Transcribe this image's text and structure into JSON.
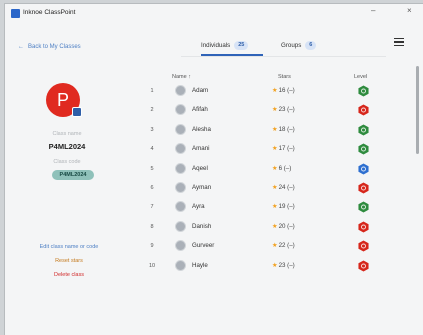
{
  "app": {
    "title": "Inknoe ClassPoint",
    "min": "–",
    "close": "×"
  },
  "nav": {
    "back": "Back to My Classes"
  },
  "tabs": [
    {
      "label": "Individuals",
      "count": "25"
    },
    {
      "label": "Groups",
      "count": "6"
    }
  ],
  "class": {
    "avatar_letter": "P",
    "name_label": "Class name",
    "name": "P4ML2024",
    "code_label": "Class code",
    "code": "P4ML2024"
  },
  "actions": {
    "edit": "Edit class name or code",
    "reset": "Reset stars",
    "delete": "Delete class"
  },
  "table": {
    "col_name": "Name ↑",
    "col_stars": "Stars",
    "col_level": "Level",
    "rows": [
      {
        "rank": "1",
        "name": "Adam",
        "stars": "16 (–)",
        "level_color": "#2e8b3e"
      },
      {
        "rank": "2",
        "name": "Afifah",
        "stars": "23 (–)",
        "level_color": "#d6261b"
      },
      {
        "rank": "3",
        "name": "Alesha",
        "stars": "18 (–)",
        "level_color": "#2e8b3e"
      },
      {
        "rank": "4",
        "name": "Amani",
        "stars": "17 (–)",
        "level_color": "#2e8b3e"
      },
      {
        "rank": "5",
        "name": "Aqeel",
        "stars": "6 (–)",
        "level_color": "#2d6fd0"
      },
      {
        "rank": "6",
        "name": "Ayman",
        "stars": "24 (–)",
        "level_color": "#d6261b"
      },
      {
        "rank": "7",
        "name": "Ayra",
        "stars": "19 (–)",
        "level_color": "#2e8b3e"
      },
      {
        "rank": "8",
        "name": "Danish",
        "stars": "20 (–)",
        "level_color": "#d6261b"
      },
      {
        "rank": "9",
        "name": "Gurveer",
        "stars": "22 (–)",
        "level_color": "#d6261b"
      },
      {
        "rank": "10",
        "name": "Hayle",
        "stars": "23 (–)",
        "level_color": "#d6261b"
      }
    ]
  },
  "colors": {
    "accent": "#2f63b8",
    "link": "#4d7fc4",
    "reset": "#c47a1e",
    "delete": "#d12a2a",
    "avatar": "#e02a20",
    "code_chip": "#8fc1ba"
  }
}
